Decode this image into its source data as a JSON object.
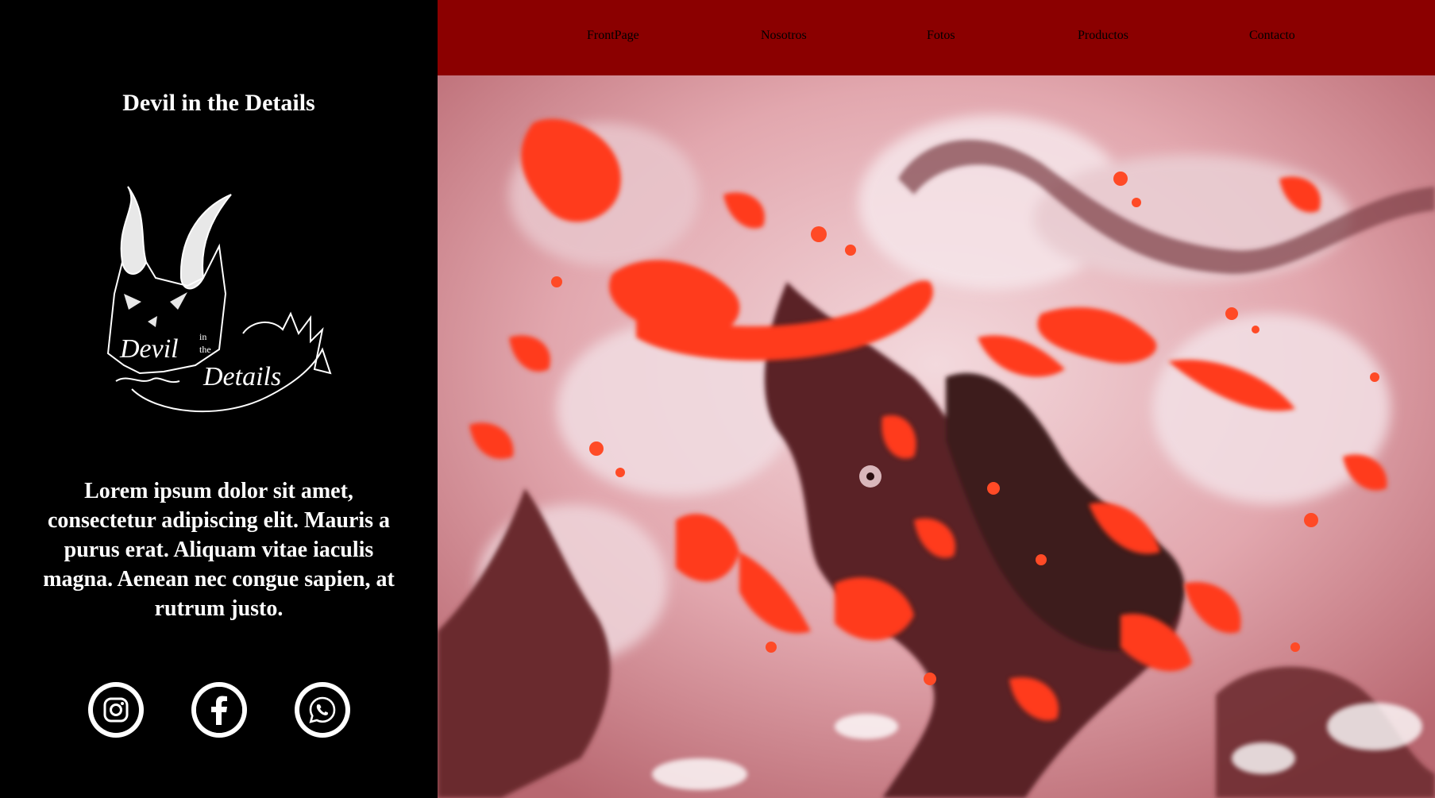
{
  "sidebar": {
    "title": "Devil in the Details",
    "logo_text_1": "Devil",
    "logo_text_2": "Details",
    "logo_small_1": "in",
    "logo_small_2": "the",
    "intro": "Lorem ipsum dolor sit amet, consectetur adipiscing elit. Mauris a purus erat. Aliquam vitae iaculis magna. Aenean nec congue sapien, at rutrum justo.",
    "socials": [
      {
        "icon": "instagram-icon"
      },
      {
        "icon": "facebook-icon"
      },
      {
        "icon": "whatsapp-icon"
      }
    ]
  },
  "nav": {
    "items": [
      {
        "label": "FrontPage"
      },
      {
        "label": "Nosotros"
      },
      {
        "label": "Fotos"
      },
      {
        "label": "Productos"
      },
      {
        "label": "Contacto"
      }
    ]
  },
  "colors": {
    "navbar": "#8b0000",
    "sidebar": "#000000",
    "accent_red": "#ff3b1f"
  }
}
